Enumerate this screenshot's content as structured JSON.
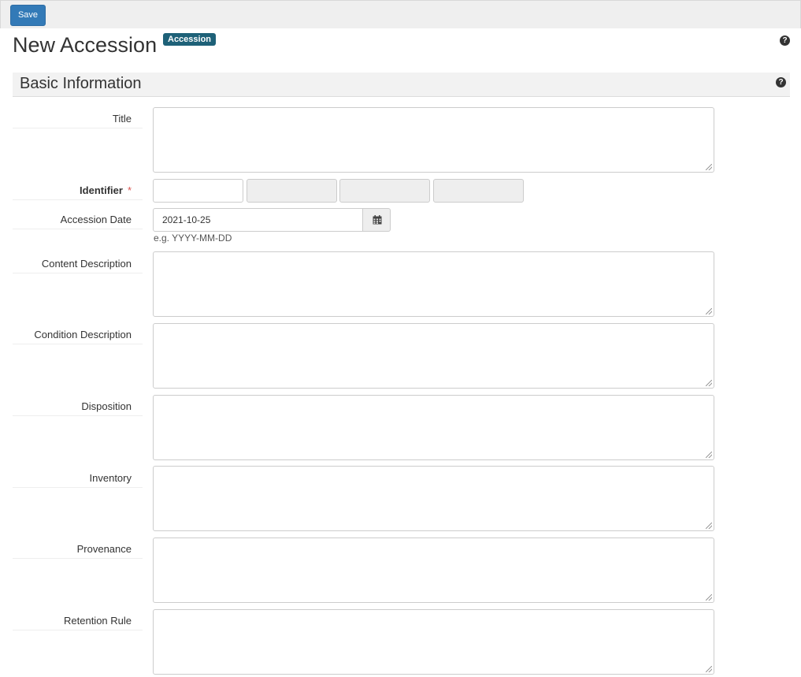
{
  "toolbar": {
    "save_label": "Save"
  },
  "header": {
    "title": "New Accession",
    "badge": "Accession",
    "help_icon": "question-circle-icon"
  },
  "section": {
    "title": "Basic Information",
    "help_icon": "question-circle-icon"
  },
  "fields": {
    "title_label": "Title",
    "identifier_label": "Identifier",
    "required_marker": "*",
    "identifier_values": [
      "",
      "",
      "",
      ""
    ],
    "accession_date_label": "Accession Date",
    "accession_date_value": "2021-10-25",
    "accession_date_hint": "e.g. YYYY-MM-DD",
    "calendar_icon": "calendar-icon",
    "content_description_label": "Content Description",
    "condition_description_label": "Condition Description",
    "disposition_label": "Disposition",
    "inventory_label": "Inventory",
    "provenance_label": "Provenance",
    "retention_rule_label": "Retention Rule"
  },
  "colors": {
    "primary": "#337ab7",
    "badge": "#1e6178",
    "required": "#d9534f"
  }
}
